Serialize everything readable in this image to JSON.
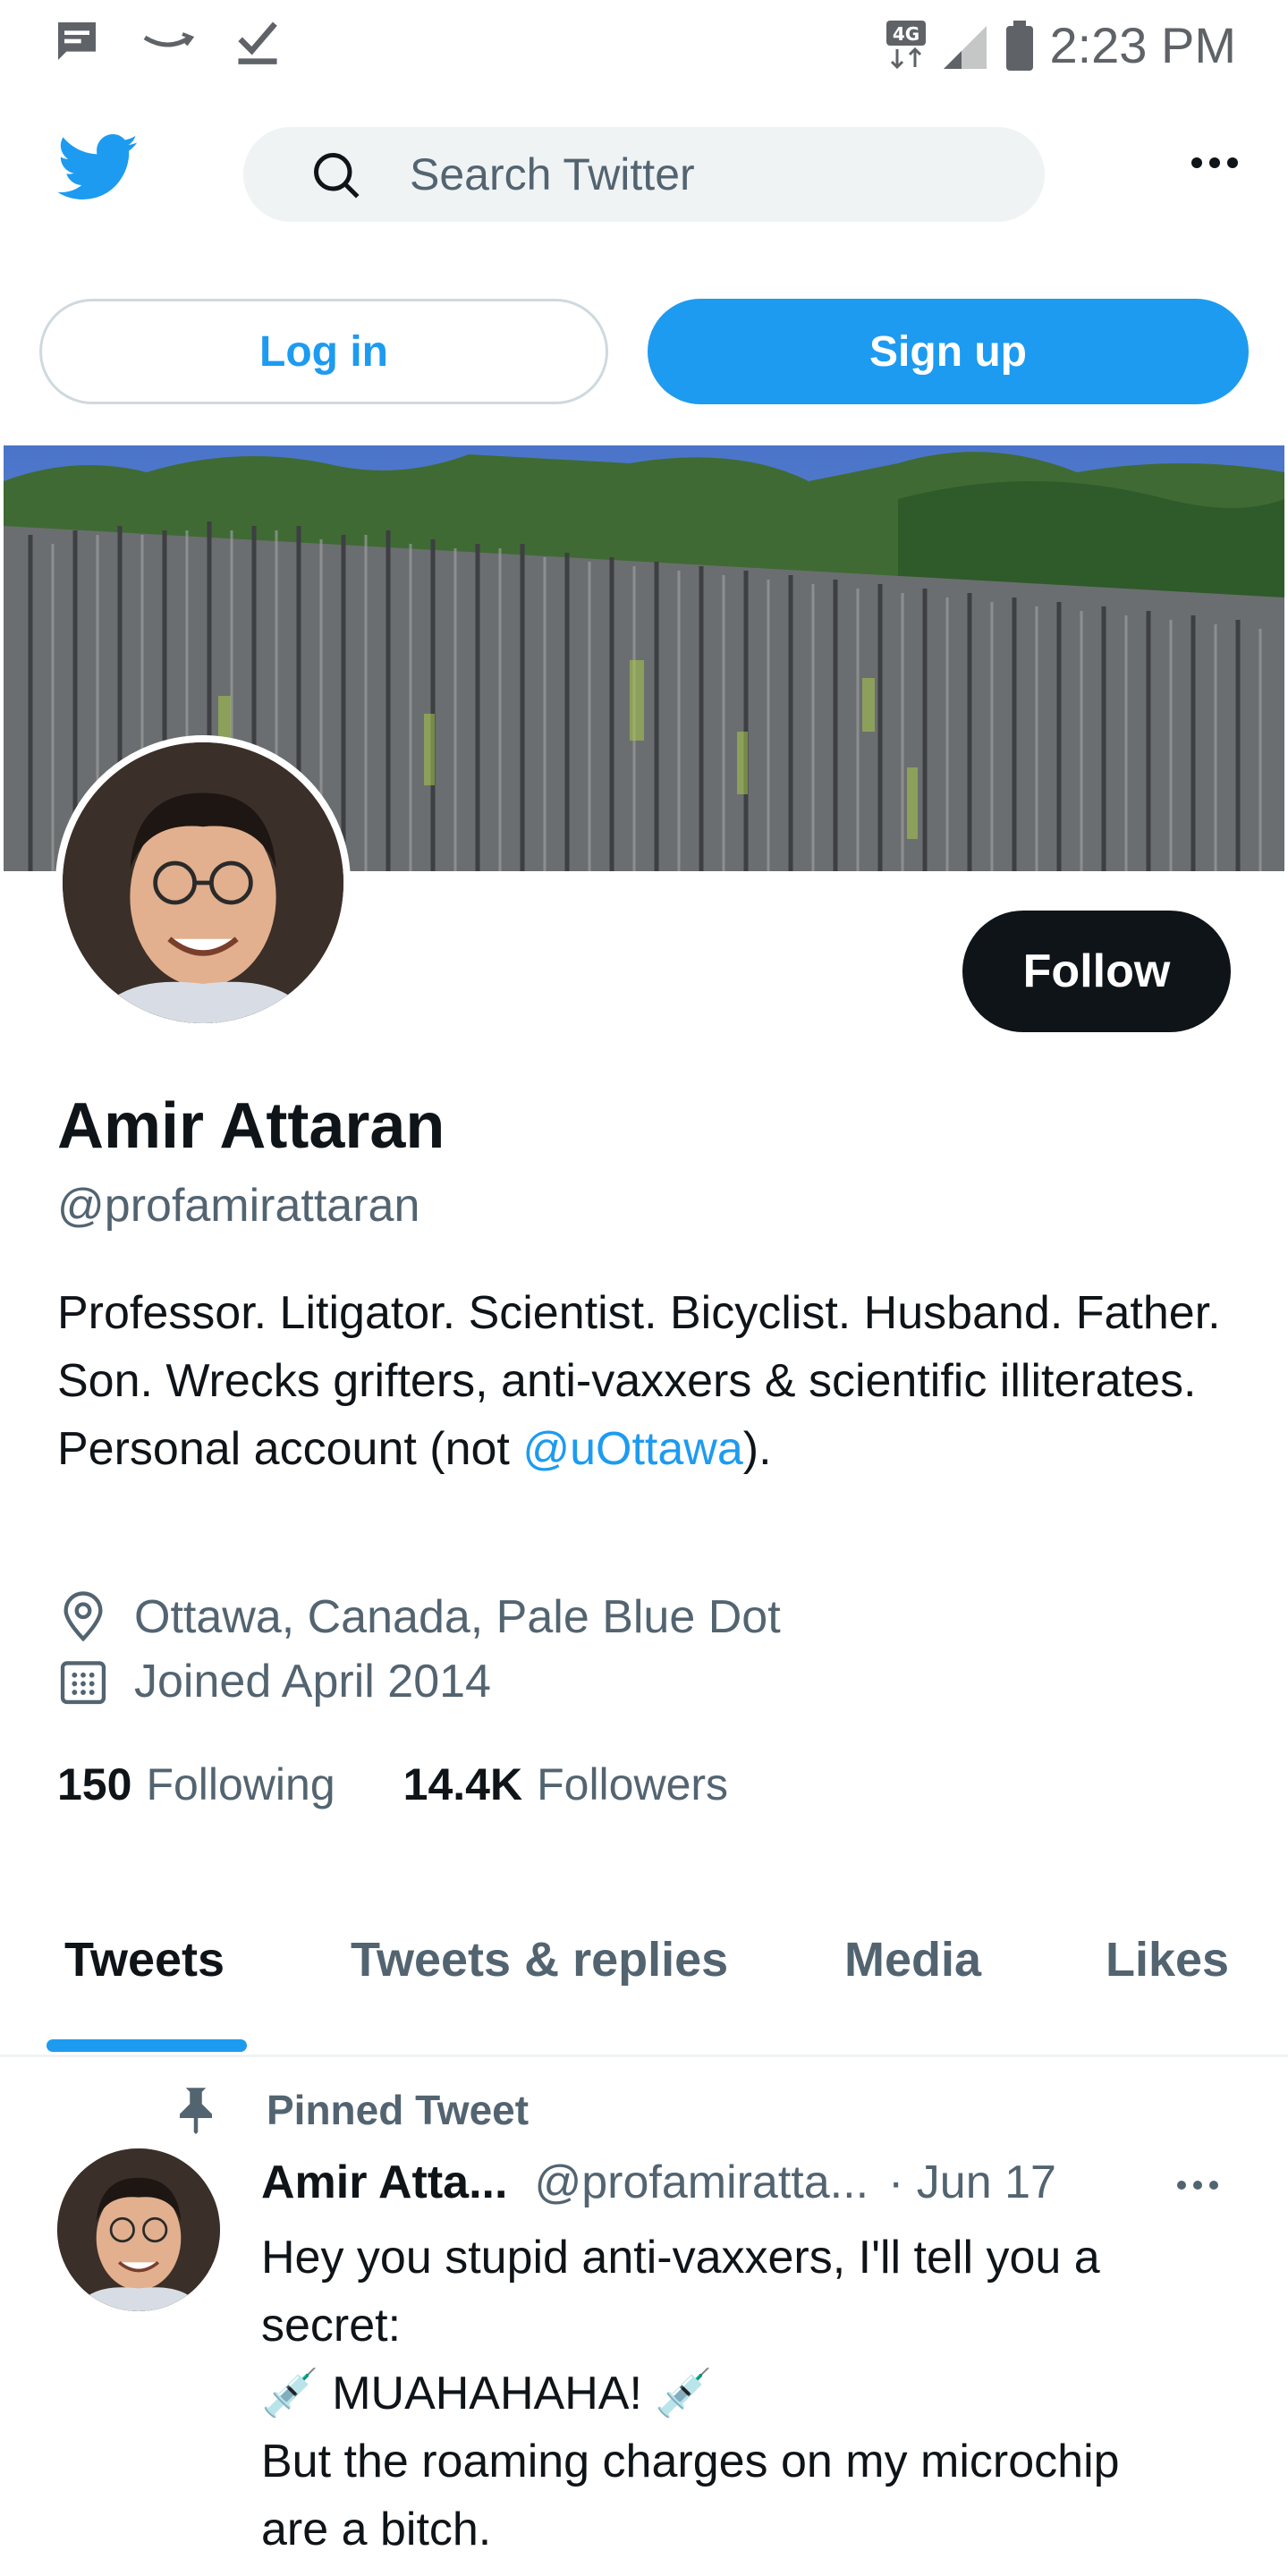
{
  "status_bar": {
    "time": "2:23 PM",
    "network": "4G",
    "icons": [
      "message-icon",
      "amazon-icon",
      "download-check-icon",
      "signal-icon",
      "battery-icon"
    ]
  },
  "header": {
    "search_placeholder": "Search Twitter"
  },
  "auth": {
    "login_label": "Log in",
    "signup_label": "Sign up"
  },
  "profile": {
    "follow_label": "Follow",
    "name": "Amir Attaran",
    "handle": "@profamirattaran",
    "bio_text": "Professor. Litigator. Scientist. Bicyclist. Husband. Father. Son. Wrecks grifters, anti-vaxxers & scientific illiterates. Personal account (not ",
    "bio_mention": "@uOttawa",
    "bio_end": ").",
    "location": "Ottawa, Canada, Pale Blue Dot",
    "joined": "Joined April 2014",
    "following_count": "150",
    "following_label": "Following",
    "followers_count": "14.4K",
    "followers_label": "Followers"
  },
  "tabs": [
    {
      "label": "Tweets",
      "active": true
    },
    {
      "label": "Tweets & replies",
      "active": false
    },
    {
      "label": "Media",
      "active": false
    },
    {
      "label": "Likes",
      "active": false
    }
  ],
  "pinned_tweet": {
    "pinned_label": "Pinned Tweet",
    "author_name": "Amir Atta...",
    "author_handle": "@profamiratta...",
    "date": "· Jun 17",
    "lines": [
      "Hey you stupid anti-vaxxers, I'll tell you a",
      "secret:",
      "💉 MUAHAHAHA! 💉",
      "But the roaming charges on my microchip",
      "are a bitch."
    ]
  },
  "colors": {
    "accent": "#1d9bf0",
    "text": "#0f1419",
    "secondary": "#536471"
  }
}
